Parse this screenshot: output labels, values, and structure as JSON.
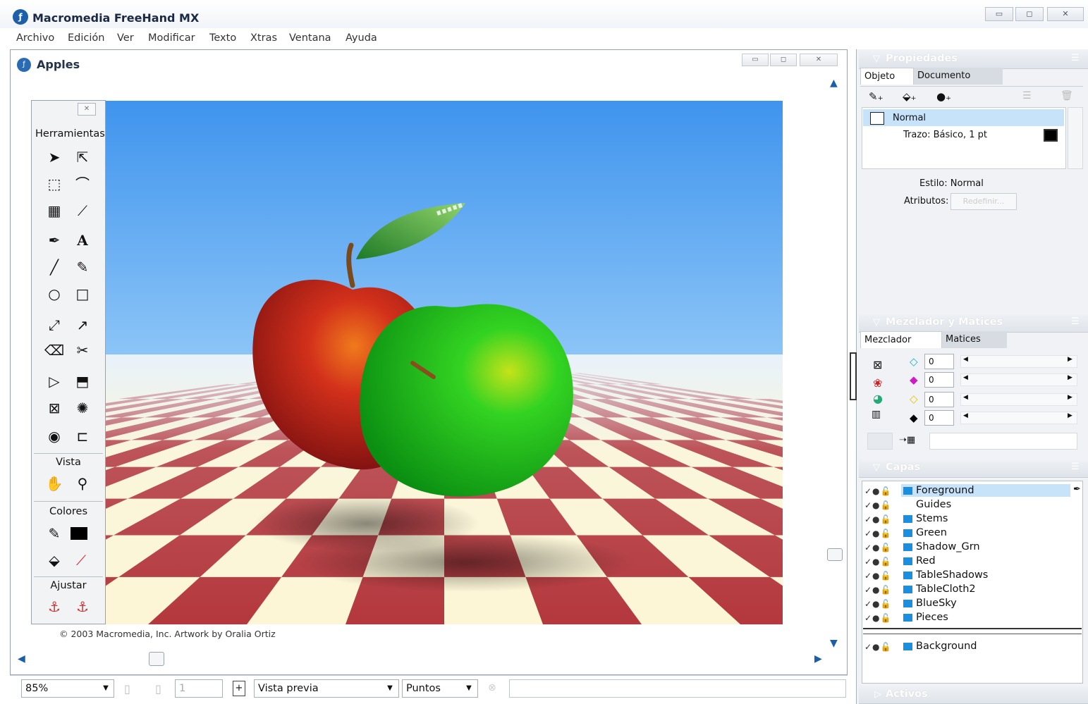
{
  "app": {
    "title": "Macromedia FreeHand MX"
  },
  "menu": [
    "Archivo",
    "Edición",
    "Ver",
    "Modificar",
    "Texto",
    "Xtras",
    "Ventana",
    "Ayuda"
  ],
  "document": {
    "title": "Apples",
    "credit": "© 2003 Macromedia, Inc. Artwork by Oralia Ortiz"
  },
  "toolbox": {
    "title": "Herramientas",
    "sections": {
      "view": "Vista",
      "colors": "Colores",
      "adjust": "Ajustar"
    }
  },
  "status": {
    "zoom": "85%",
    "page": "1",
    "view_mode": "Vista previa",
    "units": "Puntos"
  },
  "properties": {
    "title": "Propiedades",
    "tabs": [
      "Objeto",
      "Documento"
    ],
    "fill_label": "Normal",
    "stroke_label": "Trazo: Básico, 1 pt",
    "style": "Estilo: Normal",
    "attributes_label": "Atributos:",
    "redefine_button": "Redefinir..."
  },
  "mixer": {
    "title": "Mezclador y Matices",
    "tabs": [
      "Mezclador",
      "Matices"
    ],
    "channels": [
      "0",
      "0",
      "0",
      "0"
    ]
  },
  "layers": {
    "title": "Capas",
    "items": [
      "Foreground",
      "Guides",
      "Stems",
      "Green",
      "Shadow_Grn",
      "Red",
      "TableShadows",
      "TableCloth2",
      "BlueSky",
      "Pieces"
    ],
    "background": "Background"
  },
  "assets": {
    "title": "Activos"
  },
  "colors": {
    "accent": "#1a8fe0",
    "selected_row": "#c7e3fa"
  }
}
